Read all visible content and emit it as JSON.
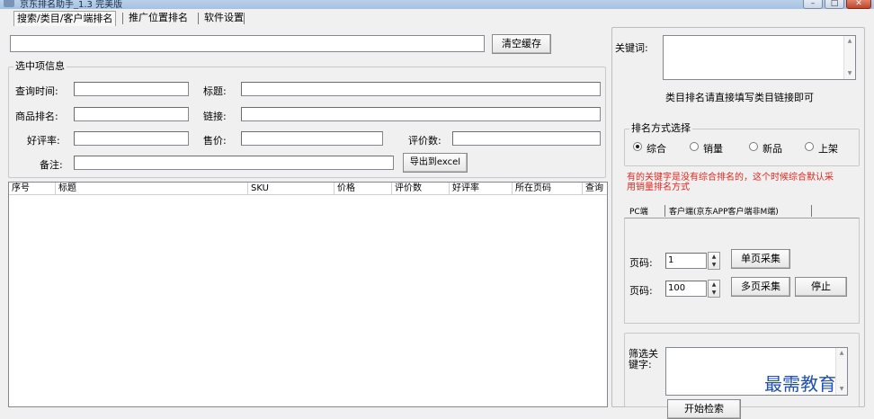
{
  "window": {
    "title": "京东排名助手_1.3 完美版",
    "buttons": [
      "–",
      "□",
      "✕"
    ]
  },
  "tabs": [
    "搜索/类目/客户端排名",
    "推广位置排名",
    "软件设置"
  ],
  "toolbar": {
    "clear_cache": "清空缓存"
  },
  "selected": {
    "group_title": "选中项信息",
    "query_time": "查询时间:",
    "title": "标题:",
    "product_rank": "商品排名:",
    "link": "链接:",
    "good_rate": "好评率:",
    "price": "售价:",
    "review_count": "评价数:",
    "note": "备注:",
    "export": "导出到excel"
  },
  "table": {
    "columns": [
      "序号",
      "标题",
      "SKU",
      "价格",
      "评价数",
      "好评率",
      "所在页码",
      "查询"
    ]
  },
  "right": {
    "keyword_label": "关键词:",
    "keyword_value": "",
    "hint": "类目排名请直接填写类目链接即可",
    "sort_group": "排名方式选择",
    "sort_options": [
      "综合",
      "销量",
      "新品",
      "上架"
    ],
    "sort_selected": "综合",
    "warning": "有的关键字是没有综合排名的，这个时候综合默认采用销量排名方式",
    "subtabs": [
      "PC端",
      "客户端(京东APP客户端非M端)"
    ],
    "page_label": "页码:",
    "page_single_value": "1",
    "page_multi_value": "100",
    "single_collect": "单页采集",
    "multi_collect": "多页采集",
    "stop": "停止",
    "filter_label": "筛选关键字:",
    "bottom_button": "开始检索"
  },
  "watermark": "最需教育"
}
